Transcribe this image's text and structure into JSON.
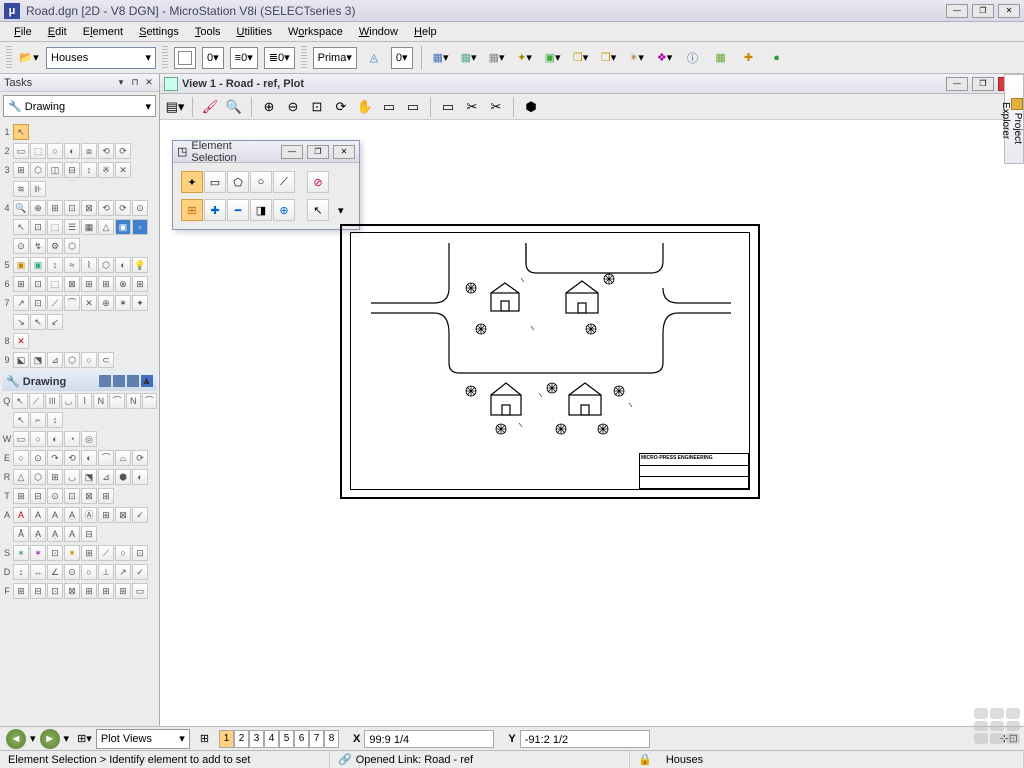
{
  "title": "Road.dgn [2D - V8 DGN] - MicroStation V8i (SELECTseries 3)",
  "menus": [
    "File",
    "Edit",
    "Element",
    "Settings",
    "Tools",
    "Utilities",
    "Workspace",
    "Window",
    "Help"
  ],
  "attributes": {
    "level": "Houses",
    "color_value": "0",
    "linestyle_value": "0",
    "lineweight_value": "0",
    "priority_label": "Prima",
    "transparency_value": "0"
  },
  "tasks": {
    "panel_title": "Tasks",
    "root_sel": "Drawing",
    "section_title": "Drawing",
    "row_labels": [
      "1",
      "2",
      "3",
      "4",
      "5",
      "6",
      "7",
      "8",
      "9"
    ],
    "group_labels": [
      "Q",
      "W",
      "E",
      "R",
      "T",
      "A",
      "S",
      "D",
      "F"
    ]
  },
  "view": {
    "title": "View 1 - Road - ref, Plot"
  },
  "element_selection": {
    "title": "Element Selection"
  },
  "titleblock": {
    "company": "MICRO-PRESS ENGINEERING"
  },
  "project_explorer": "Project Explorer",
  "viewgroup": {
    "name": "Plot Views",
    "numbers": [
      "1",
      "2",
      "3",
      "4",
      "5",
      "6",
      "7",
      "8"
    ],
    "x_label": "X",
    "x_value": "99:9 1/4",
    "y_label": "Y",
    "y_value": "-91:2 1/2"
  },
  "status": {
    "prompt": "Element Selection > Identify element to add to set",
    "link": "Opened Link: Road - ref",
    "level": "Houses"
  }
}
